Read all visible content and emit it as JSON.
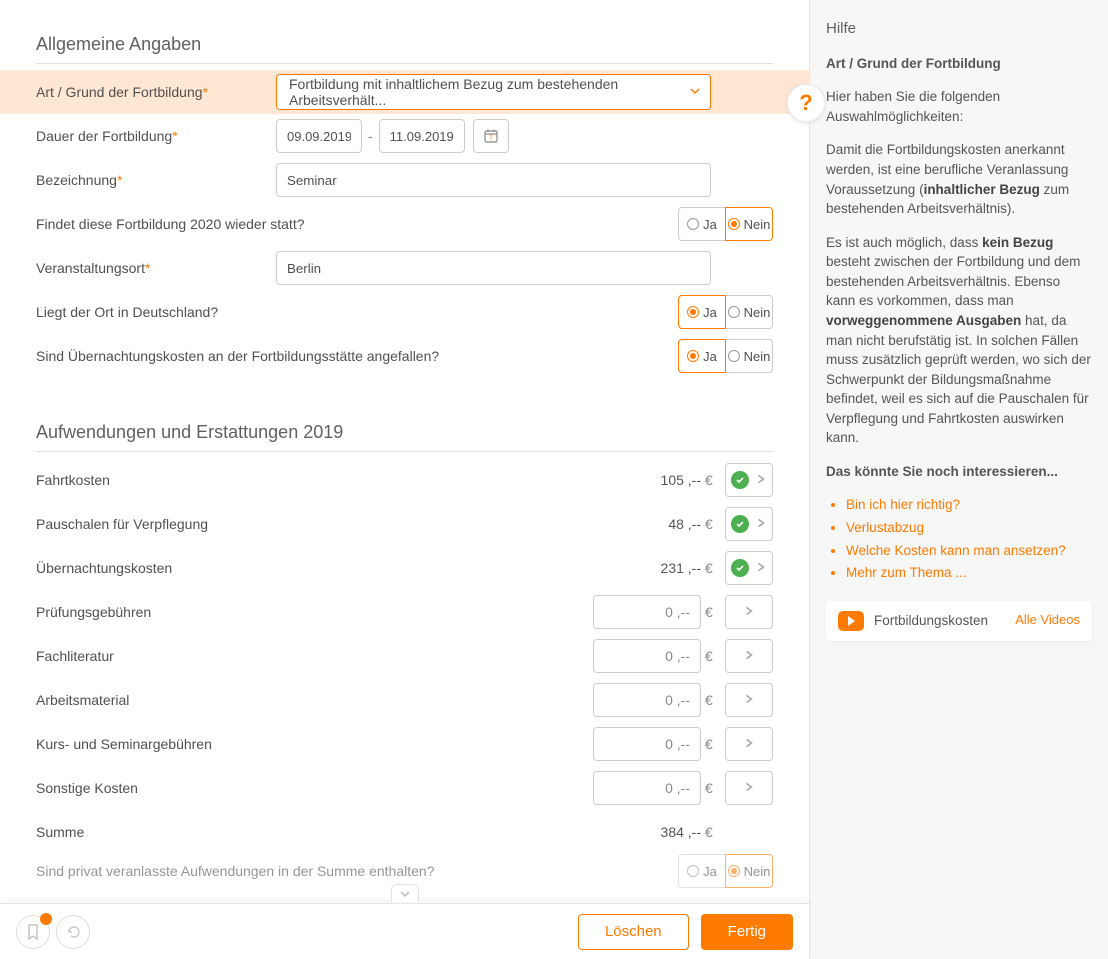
{
  "sections": {
    "general_title": "Allgemeine Angaben",
    "expenses_title": "Aufwendungen und Erstattungen 2019"
  },
  "form": {
    "art_label": "Art / Grund der Fortbildung",
    "art_value": "Fortbildung mit inhaltlichem Bezug zum bestehenden Arbeitsverhält...",
    "dauer_label": "Dauer der Fortbildung",
    "dauer_from": "09.09.2019",
    "dauer_to": "11.09.2019",
    "bezeichnung_label": "Bezeichnung",
    "bezeichnung_value": "Seminar",
    "again_label": "Findet diese Fortbildung 2020 wieder statt?",
    "ort_label": "Veranstaltungsort",
    "ort_value": "Berlin",
    "in_de_label": "Liegt der Ort in Deutschland?",
    "uebernacht_label": "Sind Übernachtungskosten an der Fortbildungsstätte angefallen?",
    "privat_label": "Sind privat veranlasste Aufwendungen in der Summe enthalten?",
    "ja": "Ja",
    "nein": "Nein"
  },
  "expenses": {
    "items": [
      {
        "label": "Fahrtkosten",
        "value": "105 ,--",
        "ok": true
      },
      {
        "label": "Pauschalen für Verpflegung",
        "value": "48 ,--",
        "ok": true
      },
      {
        "label": "Übernachtungskosten",
        "value": "231 ,--",
        "ok": true
      },
      {
        "label": "Prüfungsgebühren",
        "value": "0 ,--",
        "ok": false
      },
      {
        "label": "Fachliteratur",
        "value": "0 ,--",
        "ok": false
      },
      {
        "label": "Arbeitsmaterial",
        "value": "0 ,--",
        "ok": false
      },
      {
        "label": "Kurs- und Seminargebühren",
        "value": "0 ,--",
        "ok": false
      },
      {
        "label": "Sonstige Kosten",
        "value": "0 ,--",
        "ok": false
      }
    ],
    "sum_label": "Summe",
    "sum_value": "384 ,--",
    "currency": "€"
  },
  "footer": {
    "delete": "Löschen",
    "done": "Fertig"
  },
  "help": {
    "title": "Hilfe",
    "subtitle": "Art / Grund der Fortbildung",
    "p1": "Hier haben Sie die folgenden Auswahlmöglichkeiten:",
    "p2a": "Damit die Fortbildungskosten anerkannt werden, ist eine berufliche Veranlassung Voraussetzung (",
    "p2b": "inhaltlicher Bezug",
    "p2c": " zum bestehenden Arbeitsverhältnis).",
    "p3a": "Es ist auch möglich, dass ",
    "p3b": "kein Bezug",
    "p3c": " besteht zwischen der Fortbildung und dem bestehenden Arbeitsverhältnis. Ebenso kann es vorkommen, dass man ",
    "p3d": "vorweggenommene Ausgaben",
    "p3e": " hat, da man nicht berufstätig ist. In solchen Fällen muss zusätzlich geprüft werden, wo sich der Schwerpunkt der Bildungsmaßnahme befindet, weil es sich auf die Pauschalen für Verpflegung und Fahrtkosten auswirken kann.",
    "interest": "Das könnte Sie noch interessieren...",
    "links": [
      "Bin ich hier richtig?",
      "Verlustabzug",
      "Welche Kosten kann man ansetzen?",
      "Mehr zum Thema ..."
    ],
    "video_label": "Fortbildungskosten",
    "all_videos": "Alle Videos"
  }
}
